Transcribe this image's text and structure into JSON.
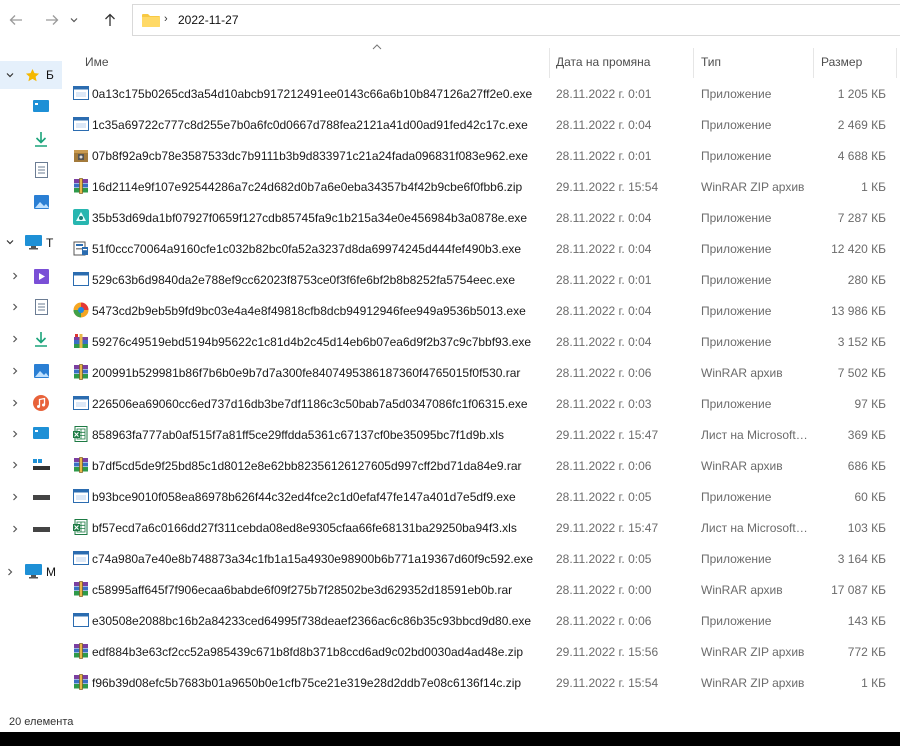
{
  "address": {
    "path": "2022-11-27",
    "separator": "›"
  },
  "nav_icons": [
    "back-arrow-icon",
    "forward-arrow-icon",
    "dropdown-chevron-icon",
    "up-arrow-icon"
  ],
  "sidebar": {
    "items": [
      {
        "name": "quick-access",
        "label": "Б",
        "expanded": true,
        "icon": "star-icon"
      },
      {
        "name": "desktop",
        "label": "",
        "icon": "desktop-icon"
      },
      {
        "name": "downloads",
        "label": "",
        "icon": "download-icon"
      },
      {
        "name": "documents",
        "label": "",
        "icon": "document-icon"
      },
      {
        "name": "pictures",
        "label": "",
        "icon": "pictures-icon"
      },
      {
        "name": "this-pc",
        "label": "Т",
        "expanded": true,
        "icon": "monitor-icon"
      },
      {
        "name": "videos",
        "label": "",
        "icon": "video-icon"
      },
      {
        "name": "documents-pc",
        "label": "",
        "icon": "document-icon"
      },
      {
        "name": "downloads-pc",
        "label": "",
        "icon": "download-icon"
      },
      {
        "name": "pictures-pc",
        "label": "",
        "icon": "pictures-icon"
      },
      {
        "name": "music",
        "label": "",
        "icon": "music-icon"
      },
      {
        "name": "desktop-pc",
        "label": "",
        "icon": "desktop-icon"
      },
      {
        "name": "local-disk",
        "label": "",
        "icon": "drive-icon"
      },
      {
        "name": "drive-2",
        "label": "",
        "icon": "drive-icon"
      },
      {
        "name": "drive-3",
        "label": "",
        "icon": "drive-icon"
      },
      {
        "name": "network",
        "label": "M",
        "icon": "network-icon"
      }
    ]
  },
  "columns": {
    "name": "Име",
    "date": "Дата на промяна",
    "type": "Тип",
    "size": "Размер"
  },
  "files": [
    {
      "name": "0a13c175b0265cd3a54d10abcb917212491ee0143c66a6b10b847126a27ff2e0.exe",
      "date": "28.11.2022 г. 0:01",
      "type": "Приложение",
      "size": "1 205 КБ",
      "icon": "app-window-icon"
    },
    {
      "name": "1c35a69722c777c8d255e7b0a6fc0d0667d788fea2121a41d00ad91fed42c17c.exe",
      "date": "28.11.2022 г. 0:04",
      "type": "Приложение",
      "size": "2 469 КБ",
      "icon": "app-window-icon"
    },
    {
      "name": "07b8f92a9cb78e3587533dc7b9111b3b9d833971c21a24fada096831f083e962.exe",
      "date": "28.11.2022 г. 0:01",
      "type": "Приложение",
      "size": "4 688 КБ",
      "icon": "installer-box-icon"
    },
    {
      "name": "16d2114e9f107e92544286a7c24d682d0b7a6e0eba34357b4f42b9cbe6f0fbb6.zip",
      "date": "29.11.2022 г. 15:54",
      "type": "WinRAR ZIP архив",
      "size": "1 КБ",
      "icon": "winrar-icon"
    },
    {
      "name": "35b53d69da1bf07927f0659f127cdb85745fa9c1b215a34e0e456984b3a0878e.exe",
      "date": "28.11.2022 г. 0:04",
      "type": "Приложение",
      "size": "7 287 КБ",
      "icon": "teal-app-icon"
    },
    {
      "name": "51f0ccc70064a9160cfe1c032b82bc0fa52a3237d8da69974245d444fef490b3.exe",
      "date": "28.11.2022 г. 0:04",
      "type": "Приложение",
      "size": "12 420 КБ",
      "icon": "setup-icon"
    },
    {
      "name": "529c63b6d9840da2e788ef9cc62023f8753ce0f3f6fe6bf2b8b8252fa5754eec.exe",
      "date": "28.11.2022 г. 0:01",
      "type": "Приложение",
      "size": "280 КБ",
      "icon": "blank-exe-icon"
    },
    {
      "name": "5473cd2b9eb5b9fd9bc03e4a4e8f49818cfb8dcb94912946fee949a9536b5013.exe",
      "date": "28.11.2022 г. 0:04",
      "type": "Приложение",
      "size": "13 986 КБ",
      "icon": "colorful-app-icon"
    },
    {
      "name": "59276c49519ebd5194b95622c1c81d4b2c45d14eb6b07ea6d9f2b37c9c7bbf93.exe",
      "date": "28.11.2022 г. 0:04",
      "type": "Приложение",
      "size": "3 152 КБ",
      "icon": "winrar-sfx-icon"
    },
    {
      "name": "200991b529981b86f7b6b0e9b7d7a300fe8407495386187360f4765015f0f530.rar",
      "date": "28.11.2022 г. 0:06",
      "type": "WinRAR архив",
      "size": "7 502 КБ",
      "icon": "winrar-icon"
    },
    {
      "name": "226506ea69060cc6ed737d16db3be7df1186c3c50bab7a5d0347086fc1f06315.exe",
      "date": "28.11.2022 г. 0:03",
      "type": "Приложение",
      "size": "97 КБ",
      "icon": "app-window-icon"
    },
    {
      "name": "858963fa777ab0af515f7a81ff5ce29ffdda5361c67137cf0be35095bc7f1d9b.xls",
      "date": "29.11.2022 г. 15:47",
      "type": "Лист на Microsoft Excel",
      "size": "369 КБ",
      "icon": "excel-icon"
    },
    {
      "name": "b7df5cd5de9f25bd85c1d8012e8e62bb82356126127605d997cff2bd71da84e9.rar",
      "date": "28.11.2022 г. 0:06",
      "type": "WinRAR архив",
      "size": "686 КБ",
      "icon": "winrar-icon"
    },
    {
      "name": "b93bce9010f058ea86978b626f44c32ed4fce2c1d0efaf47fe147a401d7e5df9.exe",
      "date": "28.11.2022 г. 0:05",
      "type": "Приложение",
      "size": "60 КБ",
      "icon": "app-window-icon"
    },
    {
      "name": "bf57ecd7a6c0166dd27f311cebda08ed8e9305cfaa66fe68131ba29250ba94f3.xls",
      "date": "29.11.2022 г. 15:47",
      "type": "Лист на Microsoft Excel",
      "size": "103 КБ",
      "icon": "excel-icon"
    },
    {
      "name": "c74a980a7e40e8b748873a34c1fb1a15a4930e98900b6b771a19367d60f9c592.exe",
      "date": "28.11.2022 г. 0:05",
      "type": "Приложение",
      "size": "3 164 КБ",
      "icon": "app-window-icon"
    },
    {
      "name": "c58995aff645f7f906ecaa6babde6f09f275b7f28502be3d629352d18591eb0b.rar",
      "date": "28.11.2022 г. 0:00",
      "type": "WinRAR архив",
      "size": "17 087 КБ",
      "icon": "winrar-icon"
    },
    {
      "name": "e30508e2088bc16b2a84233ced64995f738deaef2366ac6c86b35c93bbcd9d80.exe",
      "date": "28.11.2022 г. 0:06",
      "type": "Приложение",
      "size": "143 КБ",
      "icon": "blank-exe-icon"
    },
    {
      "name": "edf884b3e63cf2cc52a985439c671b8fd8b371b8ccd6ad9c02bd0030ad4ad48e.zip",
      "date": "29.11.2022 г. 15:56",
      "type": "WinRAR ZIP архив",
      "size": "772 КБ",
      "icon": "winrar-icon"
    },
    {
      "name": "f96b39d08efc5b7683b01a9650b0e1cfb75ce21e319e28d2ddb7e08c6136f14c.zip",
      "date": "29.11.2022 г. 15:54",
      "type": "WinRAR ZIP архив",
      "size": "1 КБ",
      "icon": "winrar-icon"
    }
  ],
  "status": {
    "count_text": "20 елемента"
  },
  "colors": {
    "selection": "#e5f0fb",
    "folder": "#f8c943",
    "accent": "#0078d4"
  }
}
